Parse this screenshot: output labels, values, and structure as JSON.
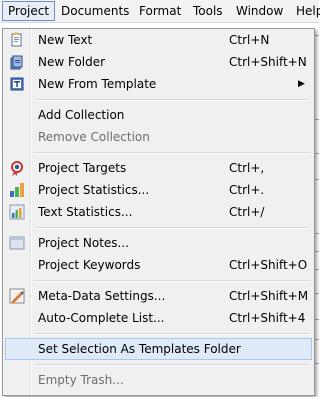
{
  "menubar": {
    "items": [
      "Project",
      "Documents",
      "Format",
      "Tools",
      "Window",
      "Help"
    ]
  },
  "menu": {
    "new_text": {
      "label": "New Text",
      "shortcut": "Ctrl+N"
    },
    "new_folder": {
      "label": "New Folder",
      "shortcut": "Ctrl+Shift+N"
    },
    "new_from_template": {
      "label": "New From Template"
    },
    "add_collection": {
      "label": "Add Collection"
    },
    "remove_collection": {
      "label": "Remove Collection"
    },
    "project_targets": {
      "label": "Project Targets",
      "shortcut": "Ctrl+,"
    },
    "project_statistics": {
      "label": "Project Statistics...",
      "shortcut": "Ctrl+."
    },
    "text_statistics": {
      "label": "Text Statistics...",
      "shortcut": "Ctrl+/"
    },
    "project_notes": {
      "label": "Project Notes..."
    },
    "project_keywords": {
      "label": "Project Keywords",
      "shortcut": "Ctrl+Shift+O"
    },
    "meta_data_settings": {
      "label": "Meta-Data Settings...",
      "shortcut": "Ctrl+Shift+M"
    },
    "auto_complete_list": {
      "label": "Auto-Complete List...",
      "shortcut": "Ctrl+Shift+4"
    },
    "set_selection_templates": {
      "label": "Set Selection As Templates Folder"
    },
    "empty_trash": {
      "label": "Empty Trash..."
    }
  },
  "icons": {
    "new_text": "new-text-icon",
    "new_folder": "new-folder-icon",
    "new_from_template": "template-icon",
    "project_targets": "target-icon",
    "project_statistics": "statistics-icon",
    "text_statistics": "text-statistics-icon",
    "project_notes": "notes-icon",
    "meta_data_settings": "metadata-icon"
  },
  "colors": {
    "hover_bg": "#dfe9f7",
    "hover_border": "#a8c6eb",
    "active_menu_border": "#6d8fc1",
    "disabled_text": "#6d6d6d"
  }
}
